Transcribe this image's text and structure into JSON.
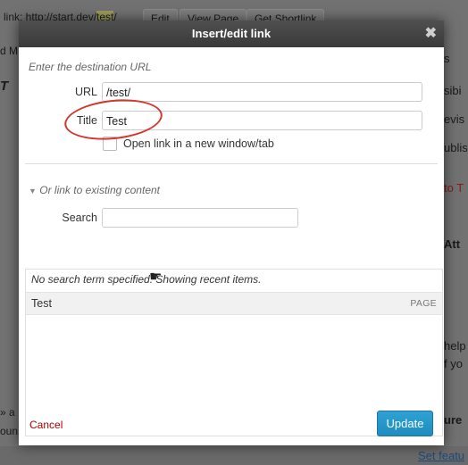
{
  "background": {
    "permalink_label": "link: http://start.dev/",
    "permalink_slug": "test",
    "permalink_tail": "/",
    "buttons": [
      "Edit",
      "View Page",
      "Get Shortlink"
    ],
    "left_fragments": [
      "d M",
      "T",
      "» a",
      "oun"
    ],
    "right_fragments": [
      "s",
      "sibi",
      "evis",
      "ublis",
      "to T",
      "Att",
      "help",
      "f yo",
      "ure",
      "Set featu"
    ]
  },
  "dialog": {
    "title": "Insert/edit link",
    "section_url": "Enter the destination URL",
    "url_label": "URL",
    "url_value": "/test/",
    "title_label": "Title",
    "title_value": "Test",
    "new_window_label": "Open link in a new window/tab",
    "section_existing": "Or link to existing content",
    "search_label": "Search",
    "search_value": "",
    "results_message": "No search term specified. Showing recent items.",
    "results": [
      {
        "title": "Test",
        "type": "PAGE"
      }
    ],
    "cancel_label": "Cancel",
    "update_label": "Update"
  },
  "colors": {
    "accent": "#1e8cbe",
    "cancel": "#aa0000",
    "annotation": "#d2372a"
  }
}
